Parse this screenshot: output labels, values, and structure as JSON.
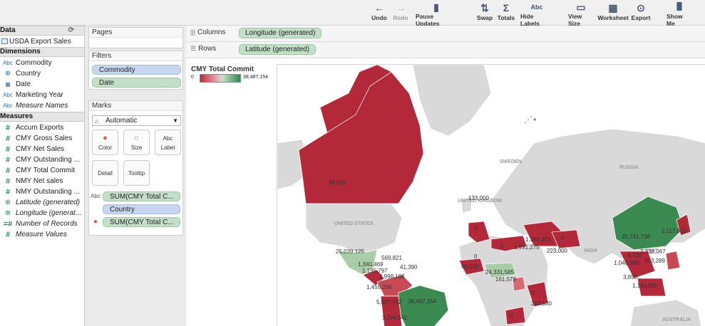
{
  "toolbar": {
    "buttons": [
      {
        "label": "Undo",
        "icon": "←",
        "icon_name": "undo-icon"
      },
      {
        "label": "Redo",
        "icon": "→",
        "icon_name": "redo-icon"
      },
      {
        "label": "Pause Updates",
        "icon": "▮",
        "icon_name": "pause-updates-icon"
      },
      {
        "label": "Swap",
        "icon": "⇅",
        "icon_name": "swap-icon"
      },
      {
        "label": "Totals",
        "icon": "Σ",
        "icon_name": "totals-icon"
      },
      {
        "label": "Hide Labels",
        "icon": "Abc",
        "icon_name": "hide-labels-icon"
      },
      {
        "label": "View Size",
        "icon": "▭",
        "icon_name": "view-size-icon"
      },
      {
        "label": "Worksheet",
        "icon": "▦",
        "icon_name": "worksheet-icon"
      },
      {
        "label": "Export",
        "icon": "⊙",
        "icon_name": "export-icon"
      },
      {
        "label": "Show Me",
        "icon": "▐▌",
        "icon_name": "show-me-icon"
      }
    ]
  },
  "data_pane": {
    "data_header": "Data",
    "data_source": "USDA Export Sales",
    "dimensions_header": "Dimensions",
    "dimensions": [
      {
        "label": "Commodity",
        "icon": "Abc",
        "type": "abc",
        "italic": false
      },
      {
        "label": "Country",
        "icon": "⊕",
        "type": "globe-b",
        "italic": false
      },
      {
        "label": "Date",
        "icon": "▦",
        "type": "abc",
        "italic": false
      },
      {
        "label": "Marketing Year",
        "icon": "Abc",
        "type": "abc",
        "italic": false
      },
      {
        "label": "Measure Names",
        "icon": "Abc",
        "type": "abc",
        "italic": true
      }
    ],
    "measures_header": "Measures",
    "measures": [
      {
        "label": "Accum Exports",
        "icon": "#",
        "type": "hash",
        "italic": false
      },
      {
        "label": "CMY Gross Sales",
        "icon": "#",
        "type": "hash",
        "italic": false
      },
      {
        "label": "CMY Net Sales",
        "icon": "#",
        "type": "hash",
        "italic": false
      },
      {
        "label": "CMY Outstanding ...",
        "icon": "#",
        "type": "hash",
        "italic": false
      },
      {
        "label": "CMY Total Commit",
        "icon": "#",
        "type": "hash",
        "italic": false
      },
      {
        "label": "NMY Net sales",
        "icon": "#",
        "type": "hash",
        "italic": false
      },
      {
        "label": "NMY Outstanding ...",
        "icon": "#",
        "type": "hash",
        "italic": false
      },
      {
        "label": "Latitude (generated)",
        "icon": "⊕",
        "type": "globe",
        "italic": true
      },
      {
        "label": "Longitude (generat...",
        "icon": "⊕",
        "type": "globe",
        "italic": true
      },
      {
        "label": "Number of Records",
        "icon": "=#",
        "type": "hash",
        "italic": true
      },
      {
        "label": "Measure Values",
        "icon": "#",
        "type": "hash",
        "italic": true
      }
    ]
  },
  "pages_card": {
    "title": "Pages"
  },
  "filters_card": {
    "title": "Filters",
    "filters": [
      "Commodity",
      "Date"
    ]
  },
  "marks_card": {
    "title": "Marks",
    "mark_type": "Automatic",
    "buttons": [
      {
        "label": "Color",
        "icon": "●"
      },
      {
        "label": "Size",
        "icon": "◌"
      },
      {
        "label": "Label",
        "icon": "Abc"
      },
      {
        "label": "Detail",
        "icon": ""
      },
      {
        "label": "Tooltip",
        "icon": ""
      }
    ],
    "fields": [
      {
        "label": "SUM(CMY Total C...",
        "color": "green",
        "icon": "Abc"
      },
      {
        "label": "Country",
        "color": "blue",
        "icon": ""
      },
      {
        "label": "SUM(CMY Total C...",
        "color": "green",
        "icon": "●"
      }
    ]
  },
  "shelves": {
    "columns_label": "Columns",
    "columns_pill": "Longitude (generated)",
    "rows_label": "Rows",
    "rows_pill": "Latitude (generated)"
  },
  "legend": {
    "title": "CMY Total Commit",
    "min": "0",
    "max": "38,487,154"
  },
  "map": {
    "colors": {
      "ocean": "#ffffff",
      "land": "#d9d9d9",
      "red": "#b3293a",
      "lightred": "#d86a73",
      "green": "#3a8a52",
      "lightgreen": "#a8cda7"
    },
    "labels": [
      {
        "text": "38,619"
      },
      {
        "text": "133,000"
      },
      {
        "text": "0"
      },
      {
        "text": "0"
      },
      {
        "text": "0"
      },
      {
        "text": "1,360,303"
      },
      {
        "text": "1,991,275"
      },
      {
        "text": "0"
      },
      {
        "text": "223,000"
      },
      {
        "text": "35,741,736"
      },
      {
        "text": "2,117,610"
      },
      {
        "text": "4,726"
      },
      {
        "text": "2,338,067"
      },
      {
        "text": "1,040,389"
      },
      {
        "text": "303,289"
      },
      {
        "text": "3,850"
      },
      {
        "text": "1,163,050"
      },
      {
        "text": "25,039,125"
      },
      {
        "text": "569,821"
      },
      {
        "text": "1,340,469"
      },
      {
        "text": "41,390"
      },
      {
        "text": "1,195,797"
      },
      {
        "text": "2,998,198"
      },
      {
        "text": "60,000"
      },
      {
        "text": "24,331,585"
      },
      {
        "text": "161,579"
      },
      {
        "text": "0"
      },
      {
        "text": "1,455,266"
      },
      {
        "text": "5,027,432"
      },
      {
        "text": "38,487,154"
      },
      {
        "text": "263,530"
      },
      {
        "text": "0"
      },
      {
        "text": "3,284,042"
      }
    ],
    "place_labels": [
      "SWEDEN",
      "RUSSIA",
      "UNITED KINGDOM",
      "UNITED STATES",
      "INDIA",
      "AUSTRALIA"
    ]
  }
}
